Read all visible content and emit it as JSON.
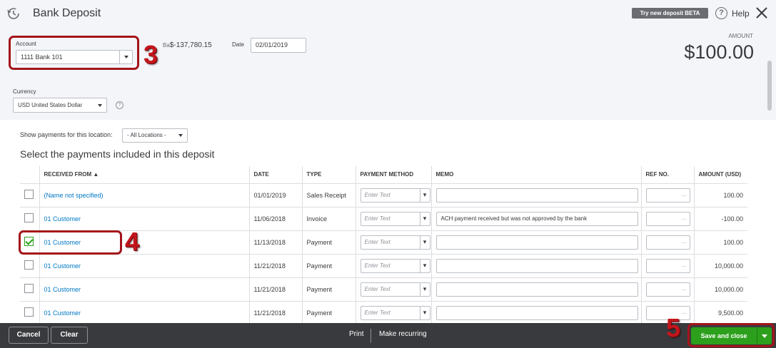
{
  "header": {
    "title": "Bank Deposit",
    "beta_button": "Try new deposit BETA",
    "help_label": "Help",
    "account_label": "Account",
    "account_value": "1111 Bank 101",
    "balance_prefix": "Ba",
    "balance_value": "$-137,780.15",
    "date_label": "Date",
    "date_value": "02/01/2019",
    "amount_label": "AMOUNT",
    "amount_value": "$100.00",
    "currency_label": "Currency",
    "currency_value": "USD United States Dollar"
  },
  "filter": {
    "location_label": "Show payments for this location:",
    "location_value": "- All Locations -"
  },
  "section_title": "Select the payments included in this deposit",
  "table": {
    "columns": [
      "RECEIVED FROM ▲",
      "DATE",
      "TYPE",
      "PAYMENT METHOD",
      "MEMO",
      "REF NO.",
      "AMOUNT (USD)"
    ],
    "placeholder": "Enter Text",
    "rows": [
      {
        "checked": false,
        "from": "(Name not specified)",
        "date": "01/01/2019",
        "type": "Sales Receipt",
        "memo": "",
        "amount": "100.00"
      },
      {
        "checked": false,
        "from": "01 Customer",
        "date": "11/06/2018",
        "type": "Invoice",
        "memo": "ACH payment received but was not approved by the bank",
        "amount": "-100.00"
      },
      {
        "checked": true,
        "from": "01 Customer",
        "date": "11/13/2018",
        "type": "Payment",
        "memo": "",
        "amount": "100.00"
      },
      {
        "checked": false,
        "from": "01 Customer",
        "date": "11/21/2018",
        "type": "Payment",
        "memo": "",
        "amount": "10,000.00"
      },
      {
        "checked": false,
        "from": "01 Customer",
        "date": "11/21/2018",
        "type": "Payment",
        "memo": "",
        "amount": "10,000.00"
      },
      {
        "checked": false,
        "from": "01 Customer",
        "date": "11/21/2018",
        "type": "Payment",
        "memo": "",
        "amount": "9,500.00"
      }
    ]
  },
  "footer": {
    "cancel": "Cancel",
    "clear": "Clear",
    "print": "Print",
    "make_recurring": "Make recurring",
    "save_and_close": "Save and close"
  },
  "annotations": {
    "step3": "3",
    "step4": "4",
    "step5": "5"
  },
  "colors": {
    "accent_green": "#2ca01c",
    "link_blue": "#0077c5",
    "annotation_red": "#c4151c",
    "footer_bg": "#393a3d"
  }
}
